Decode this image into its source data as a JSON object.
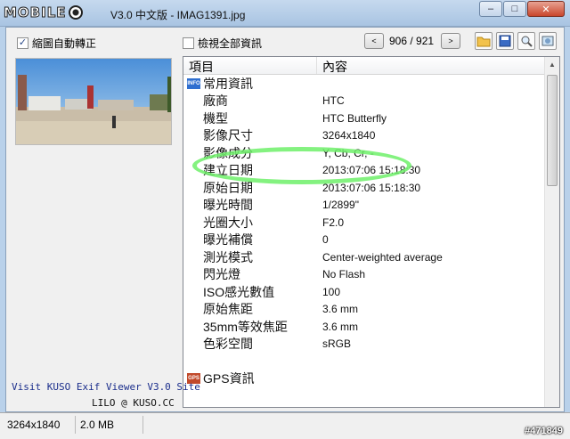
{
  "window": {
    "logo_text": "MOBILE",
    "title": "V3.0 中文版 - IMAG1391.jpg",
    "minimize": "–",
    "maximize": "□",
    "close": "✕"
  },
  "toolbar": {
    "auto_rotate_label": "縮圖自動轉正",
    "auto_rotate_checked": "✓",
    "show_all_label": "檢視全部資訊",
    "prev": "<",
    "next": ">",
    "counter": "906 / 921"
  },
  "list": {
    "col_item": "項目",
    "col_content": "內容",
    "groups": [
      {
        "label": "常用資訊",
        "icon": "info-icon",
        "rows": [
          {
            "k": "廠商",
            "v": "HTC"
          },
          {
            "k": "機型",
            "v": "HTC Butterfly"
          },
          {
            "k": "影像尺寸",
            "v": "3264x1840"
          },
          {
            "k": "影像成分",
            "v": "Y, Cb, Cr, -"
          },
          {
            "k": "建立日期",
            "v": "2013:07:06 15:18:30"
          },
          {
            "k": "原始日期",
            "v": "2013:07:06 15:18:30"
          },
          {
            "k": "曝光時間",
            "v": "1/2899\""
          },
          {
            "k": "光圈大小",
            "v": "F2.0"
          },
          {
            "k": "曝光補償",
            "v": "0"
          },
          {
            "k": "測光模式",
            "v": "Center-weighted average"
          },
          {
            "k": "閃光燈",
            "v": "No Flash"
          },
          {
            "k": "ISO感光數值",
            "v": "100"
          },
          {
            "k": "原始焦距",
            "v": "3.6 mm"
          },
          {
            "k": "35mm等效焦距",
            "v": "3.6 mm"
          },
          {
            "k": "色彩空間",
            "v": "sRGB"
          }
        ]
      },
      {
        "label": "GPS資訊",
        "icon": "gps-icon",
        "rows": []
      }
    ]
  },
  "promo": "Visit KUSO Exif Viewer V3.0 Site",
  "credit": "LILO @ KUSO.CC",
  "status": {
    "dimensions": "3264x1840",
    "size": "2.0 MB"
  },
  "watermark": "#471849"
}
